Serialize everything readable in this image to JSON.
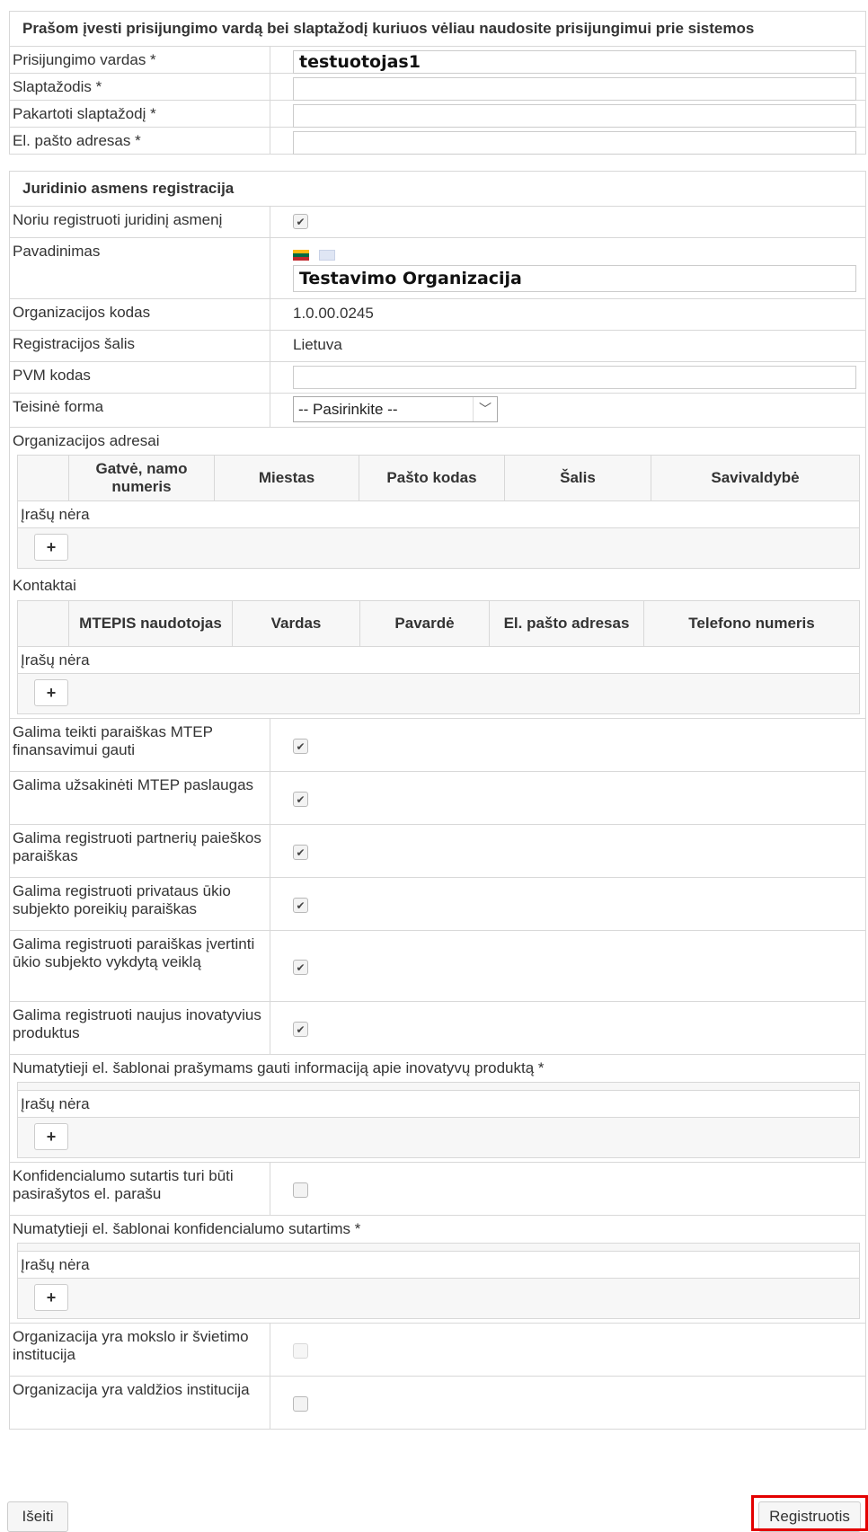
{
  "login": {
    "header": "Prašom įvesti prisijungimo vardą bei slaptažodį kuriuos vėliau naudosite prisijungimui prie sistemos",
    "username_label": "Prisijungimo vardas *",
    "username_value": "testuotojas1",
    "password_label": "Slaptažodis *",
    "password_repeat_label": "Pakartoti slaptažodį *",
    "email_label": "El. pašto adresas *"
  },
  "legal": {
    "header": "Juridinio asmens registracija",
    "register_label": "Noriu registruoti juridinį asmenį",
    "register_checked": true,
    "name_label": "Pavadinimas",
    "name_value": "Testavimo Organizacija",
    "code_label": "Organizacijos kodas",
    "code_value": "1.0.00.0245",
    "country_label": "Registracijos šalis",
    "country_value": "Lietuva",
    "vat_label": "PVM kodas",
    "legal_form_label": "Teisinė forma",
    "legal_form_value": "-- Pasirinkite --"
  },
  "addresses": {
    "label": "Organizacijos adresai",
    "columns": [
      "Gatvė, namo numeris",
      "Miestas",
      "Pašto kodas",
      "Šalis",
      "Savivaldybė"
    ],
    "empty": "Įrašų nėra"
  },
  "contacts": {
    "label": "Kontaktai",
    "columns": [
      "MTEPIS naudotojas",
      "Vardas",
      "Pavardė",
      "El. pašto adresas",
      "Telefono numeris"
    ],
    "empty": "Įrašų nėra"
  },
  "permissions": [
    {
      "label": "Galima teikti paraiškas MTEP finansavimui gauti",
      "checked": true
    },
    {
      "label": "Galima užsakinėti MTEP paslaugas",
      "checked": true
    },
    {
      "label": "Galima registruoti partnerių paieškos paraiškas",
      "checked": true
    },
    {
      "label": "Galima registruoti privataus ūkio subjekto poreikių paraiškas",
      "checked": true
    },
    {
      "label": "Galima registruoti paraiškas įvertinti ūkio subjekto vykdytą veiklą",
      "checked": true
    },
    {
      "label": "Galima registruoti naujus inovatyvius produktus",
      "checked": true
    }
  ],
  "templates_products": {
    "label": "Numatytieji el. šablonai prašymams gauti informaciją apie inovatyvų produktą *",
    "empty": "Įrašų nėra"
  },
  "confidential": {
    "label": "Konfidencialumo sutartis turi būti pasirašytos el. parašu",
    "checked": false
  },
  "templates_confidential": {
    "label": "Numatytieji el. šablonai konfidencialumo sutartims *",
    "empty": "Įrašų nėra"
  },
  "science_institution": {
    "label": "Organizacija yra mokslo ir švietimo institucija",
    "checked": false
  },
  "government_institution": {
    "label": "Organizacija yra valdžios institucija",
    "checked": false
  },
  "buttons": {
    "add": "+",
    "exit": "Išeiti",
    "register": "Registruotis"
  },
  "colors": {
    "highlight": "#e30000",
    "border": "#d8d8d8"
  }
}
